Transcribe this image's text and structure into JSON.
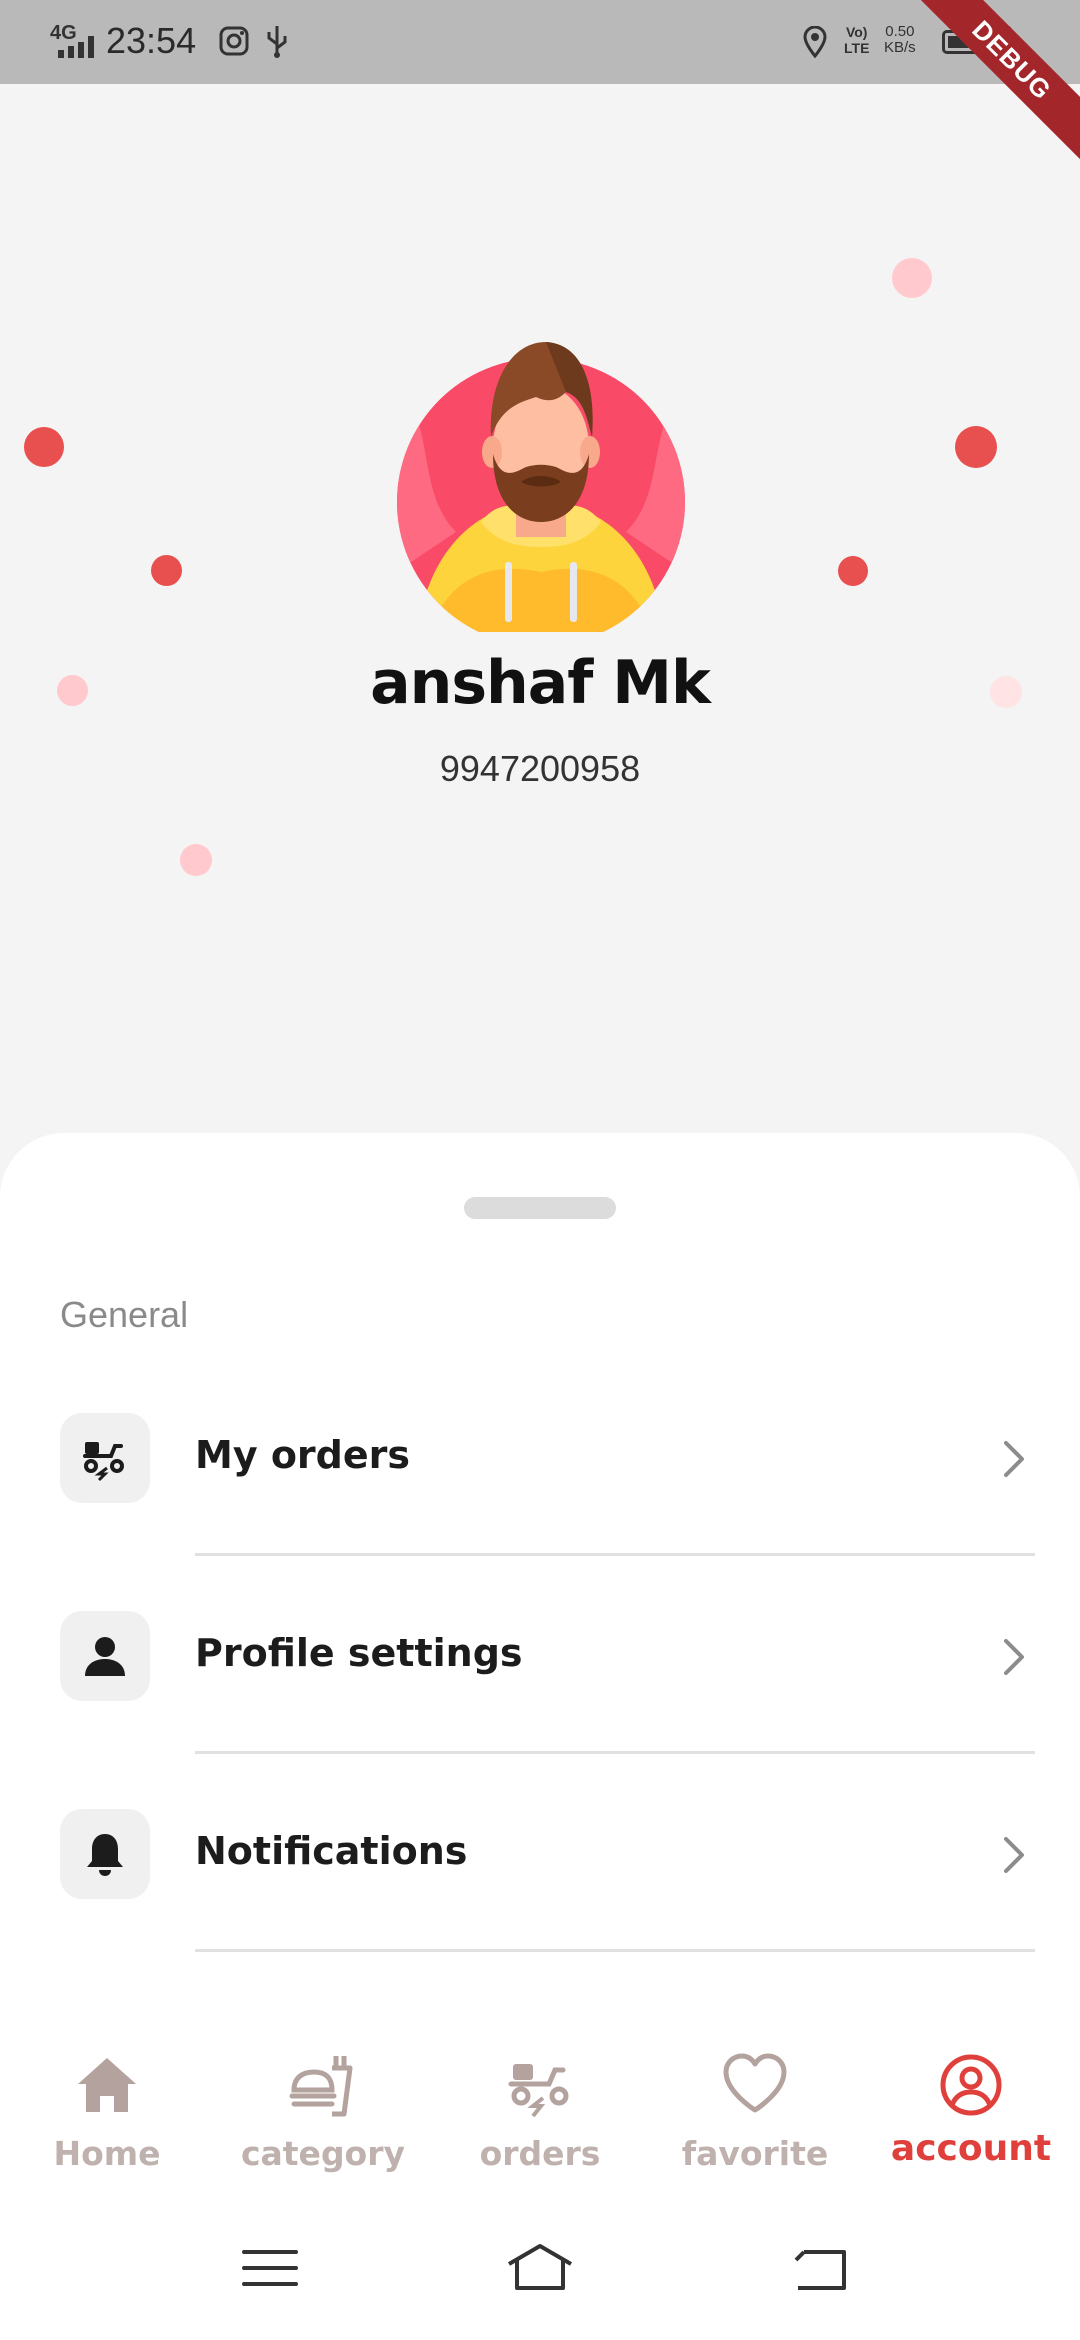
{
  "status_bar": {
    "network": "4G",
    "time": "23:54",
    "volte_top": "Vo)",
    "volte_bottom": "LTE",
    "speed_value": "0.50",
    "speed_unit": "KB/s",
    "battery_level": 0.6
  },
  "debug_banner": "DEBUG",
  "profile": {
    "name": "anshaf Mk",
    "phone": "9947200958"
  },
  "sheet": {
    "section_title": "General",
    "items": [
      {
        "label": "My orders",
        "icon": "scooter-icon"
      },
      {
        "label": "Profile settings",
        "icon": "person-icon"
      },
      {
        "label": "Notifications",
        "icon": "bell-icon"
      }
    ]
  },
  "bottom_nav": {
    "active": "account",
    "items": [
      {
        "label": "Home",
        "icon": "home-icon"
      },
      {
        "label": "category",
        "icon": "food-tray-icon"
      },
      {
        "label": "orders",
        "icon": "scooter-icon"
      },
      {
        "label": "favorite",
        "icon": "heart-icon"
      },
      {
        "label": "account",
        "icon": "account-circle-icon"
      }
    ]
  },
  "colors": {
    "accent": "#e0403b",
    "nav_inactive": "#bfb1ad",
    "background": "#f5f4f4",
    "debug_ribbon": "#a3262b"
  }
}
